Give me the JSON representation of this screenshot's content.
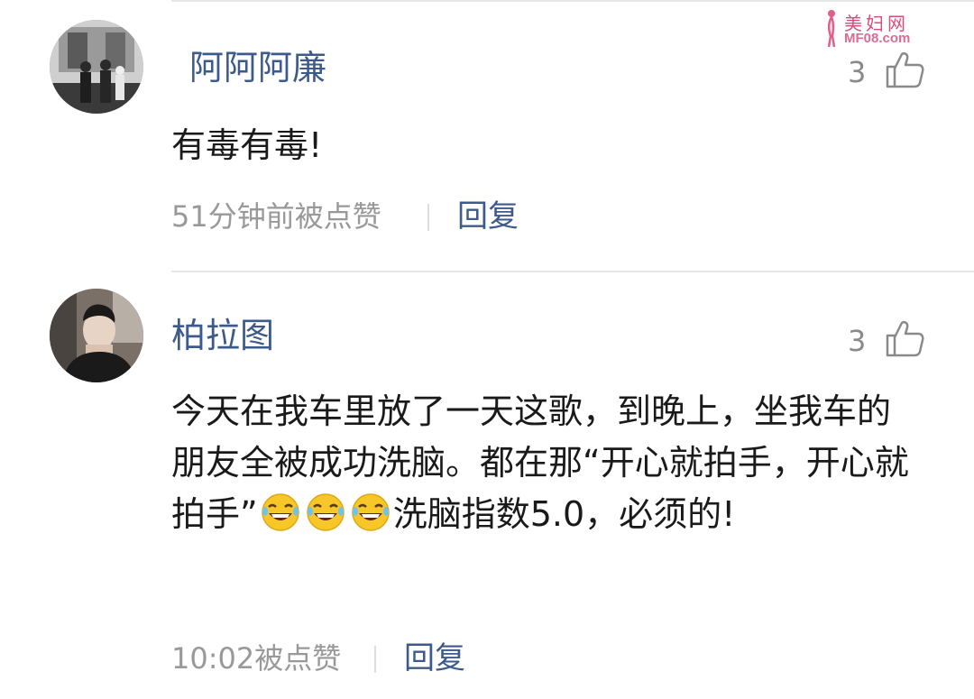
{
  "watermark": {
    "name": "美妇网",
    "url": "MF08.com"
  },
  "comments": [
    {
      "username": "阿阿阿廉",
      "likes": "3",
      "text": "有毒有毒!",
      "meta": "51分钟前被点赞",
      "reply_label": "回复",
      "avatar_icon": "avatar-photo"
    },
    {
      "username": "柏拉图",
      "likes": "3",
      "text_part1": "今天在我车里放了一天这歌，到晚上，坐我车的朋友全被成功洗脑。都在那“开心就拍手，开心就拍手”",
      "emoji_name": "laughing-tears-emoji",
      "emoji_count": 3,
      "text_part2": "洗脑指数5.0，必须的!",
      "meta": "10:02被点赞",
      "reply_label": "回复",
      "avatar_icon": "avatar-photo"
    }
  ],
  "colors": {
    "username": "#3d5a8c",
    "meta": "#999999",
    "text": "#1a1a1a",
    "divider": "#e6e6e6"
  }
}
